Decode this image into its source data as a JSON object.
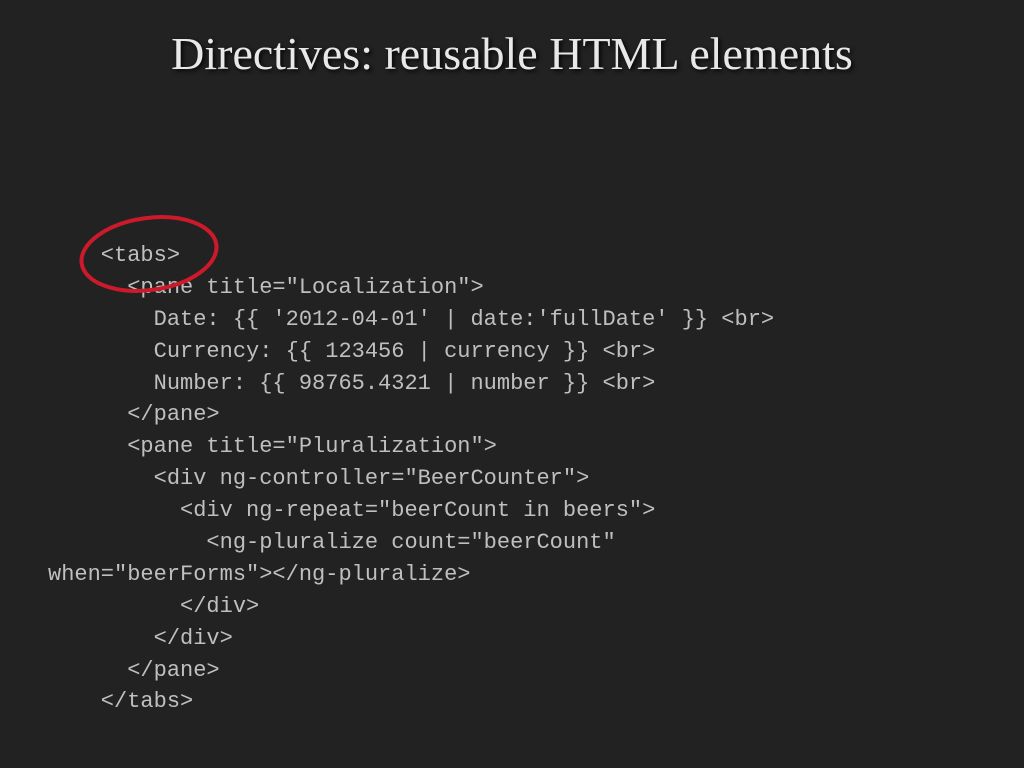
{
  "title": "Directives: reusable HTML elements",
  "code": "    <tabs>\n      <pane title=\"Localization\">\n        Date: {{ '2012-04-01' | date:'fullDate' }} <br>\n        Currency: {{ 123456 | currency }} <br>\n        Number: {{ 98765.4321 | number }} <br>\n      </pane>\n      <pane title=\"Pluralization\">\n        <div ng-controller=\"BeerCounter\">\n          <div ng-repeat=\"beerCount in beers\">\n            <ng-pluralize count=\"beerCount\"\nwhen=\"beerForms\"></ng-pluralize>\n          </div>\n        </div>\n      </pane>\n    </tabs>",
  "annotation": {
    "shape": "ellipse",
    "color": "#cc1a2a",
    "target": "tabs-tag"
  }
}
